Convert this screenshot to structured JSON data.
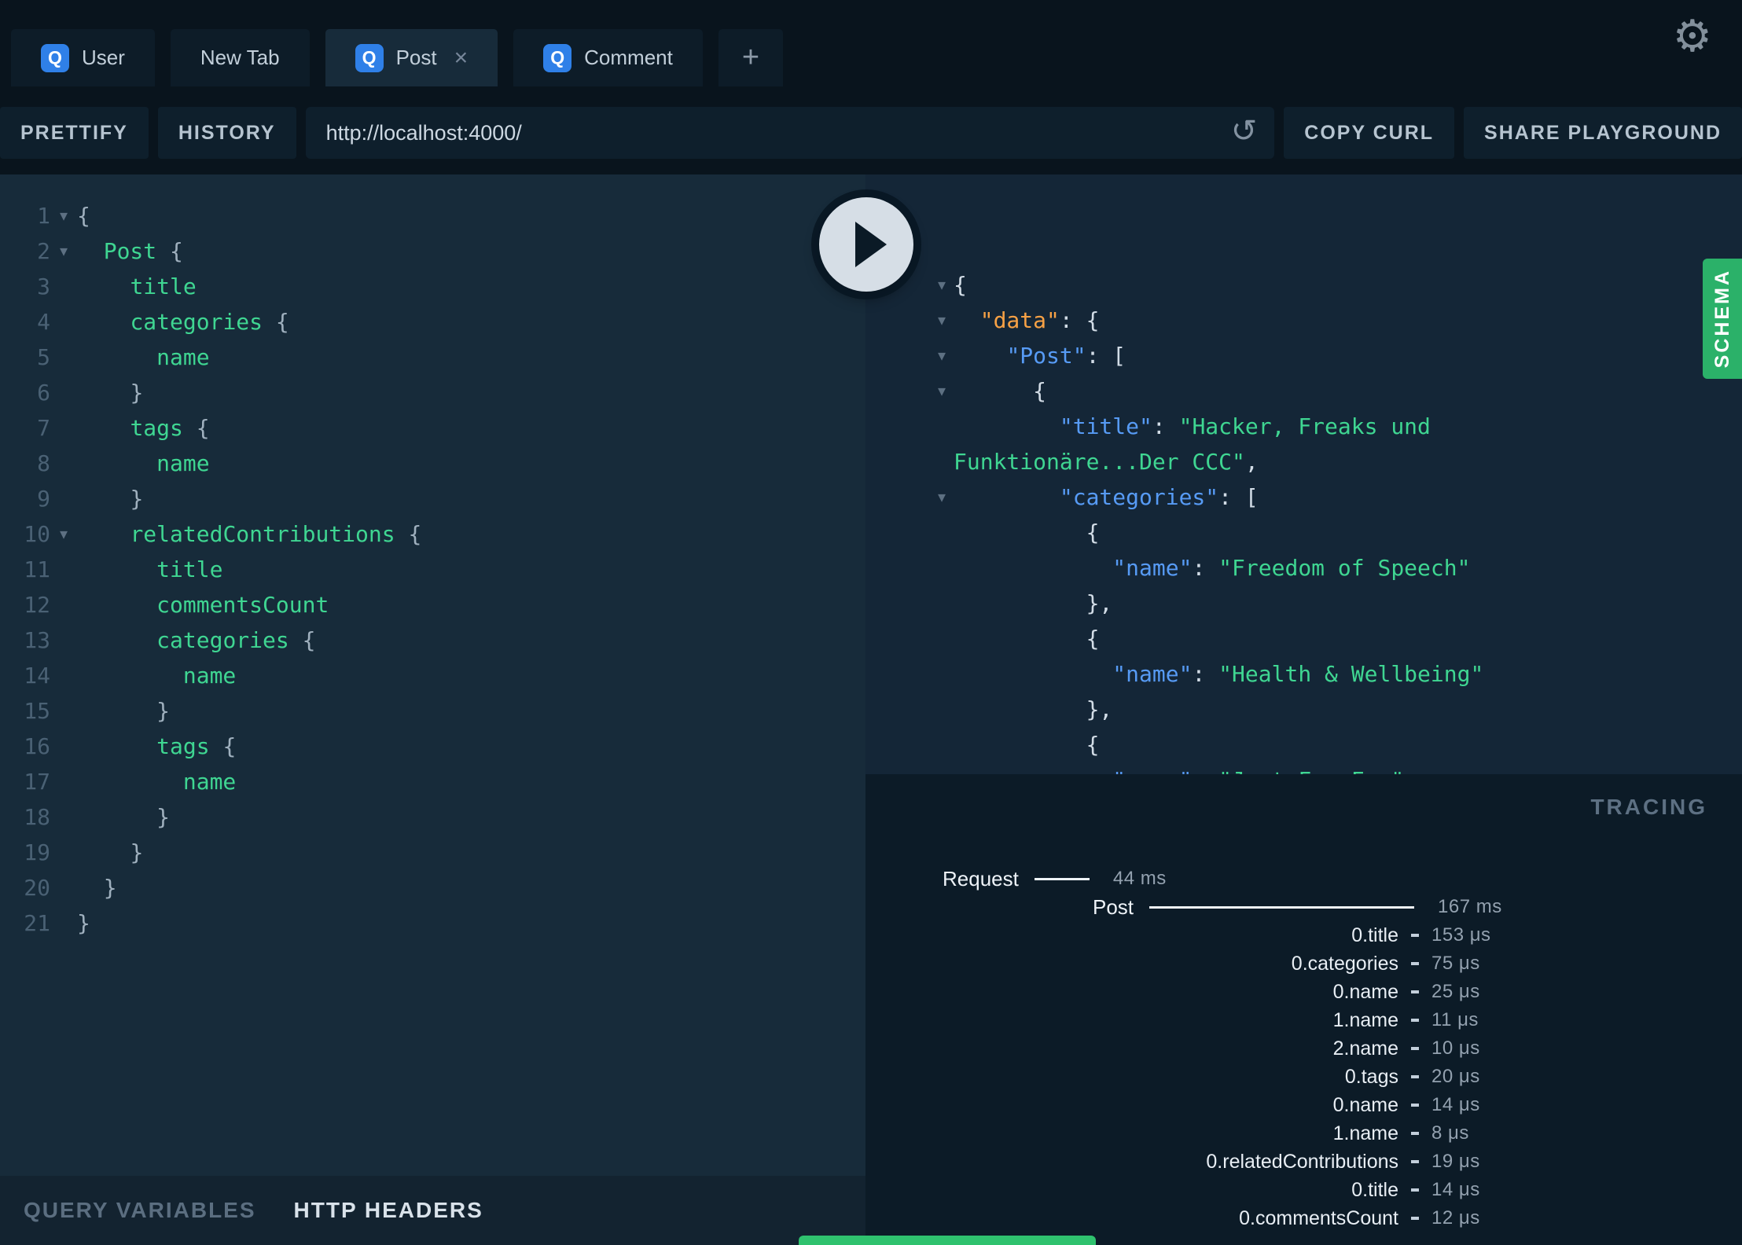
{
  "colors": {
    "topbar": "#09141d",
    "panel-editor": "#172b3a",
    "panel-result": "#142637",
    "panel-tracing": "#0c1b27",
    "badge-blue": "#2f80e8",
    "schema-green": "#2bb169",
    "field-green": "#3fd692",
    "key-blue": "#579bf5",
    "data-orange": "#f7a145",
    "string-green": "#3fd692",
    "toast-green": "#2fc26e"
  },
  "icons": {
    "fold": "▾",
    "close": "×",
    "gear": "⚙",
    "reload": "↺"
  },
  "tab_bar": {
    "plus_label": "+",
    "tabs": [
      {
        "label": "User",
        "badge": "Q",
        "active": false,
        "closable": false
      },
      {
        "label": "New Tab",
        "badge": null,
        "active": false,
        "closable": false
      },
      {
        "label": "Post",
        "badge": "Q",
        "active": true,
        "closable": true
      },
      {
        "label": "Comment",
        "badge": "Q",
        "active": false,
        "closable": false
      }
    ]
  },
  "toolbar": {
    "prettify": "PRETTIFY",
    "history": "HISTORY",
    "endpoint": "http://localhost:4000/",
    "copy_curl": "COPY CURL",
    "share": "SHARE PLAYGROUND"
  },
  "query_editor": {
    "lines": [
      {
        "num": 1,
        "fold": true,
        "segs": [
          [
            "{",
            "p"
          ]
        ]
      },
      {
        "num": 2,
        "fold": true,
        "segs": [
          [
            "  ",
            ""
          ],
          [
            "Post",
            "f"
          ],
          [
            " {",
            "p"
          ]
        ]
      },
      {
        "num": 3,
        "fold": false,
        "segs": [
          [
            "    ",
            ""
          ],
          [
            "title",
            "f"
          ]
        ]
      },
      {
        "num": 4,
        "fold": false,
        "segs": [
          [
            "    ",
            ""
          ],
          [
            "categories",
            "f"
          ],
          [
            " {",
            "p"
          ]
        ]
      },
      {
        "num": 5,
        "fold": false,
        "segs": [
          [
            "      ",
            ""
          ],
          [
            "name",
            "f"
          ]
        ]
      },
      {
        "num": 6,
        "fold": false,
        "segs": [
          [
            "    ",
            ""
          ],
          [
            "}",
            "p"
          ]
        ]
      },
      {
        "num": 7,
        "fold": false,
        "segs": [
          [
            "    ",
            ""
          ],
          [
            "tags",
            "f"
          ],
          [
            " {",
            "p"
          ]
        ]
      },
      {
        "num": 8,
        "fold": false,
        "segs": [
          [
            "      ",
            ""
          ],
          [
            "name",
            "f"
          ]
        ]
      },
      {
        "num": 9,
        "fold": false,
        "segs": [
          [
            "    ",
            ""
          ],
          [
            "}",
            "p"
          ]
        ]
      },
      {
        "num": 10,
        "fold": true,
        "segs": [
          [
            "    ",
            ""
          ],
          [
            "relatedContributions",
            "f"
          ],
          [
            " {",
            "p"
          ]
        ]
      },
      {
        "num": 11,
        "fold": false,
        "segs": [
          [
            "      ",
            ""
          ],
          [
            "title",
            "f"
          ]
        ]
      },
      {
        "num": 12,
        "fold": false,
        "segs": [
          [
            "      ",
            ""
          ],
          [
            "commentsCount",
            "f"
          ]
        ]
      },
      {
        "num": 13,
        "fold": false,
        "segs": [
          [
            "      ",
            ""
          ],
          [
            "categories",
            "f"
          ],
          [
            " {",
            "p"
          ]
        ]
      },
      {
        "num": 14,
        "fold": false,
        "segs": [
          [
            "        ",
            ""
          ],
          [
            "name",
            "f"
          ]
        ]
      },
      {
        "num": 15,
        "fold": false,
        "segs": [
          [
            "      ",
            ""
          ],
          [
            "}",
            "p"
          ]
        ]
      },
      {
        "num": 16,
        "fold": false,
        "segs": [
          [
            "      ",
            ""
          ],
          [
            "tags",
            "f"
          ],
          [
            " {",
            "p"
          ]
        ]
      },
      {
        "num": 17,
        "fold": false,
        "segs": [
          [
            "        ",
            ""
          ],
          [
            "name",
            "f"
          ]
        ]
      },
      {
        "num": 18,
        "fold": false,
        "segs": [
          [
            "      ",
            ""
          ],
          [
            "}",
            "p"
          ]
        ]
      },
      {
        "num": 19,
        "fold": false,
        "segs": [
          [
            "    ",
            ""
          ],
          [
            "}",
            "p"
          ]
        ]
      },
      {
        "num": 20,
        "fold": false,
        "segs": [
          [
            "  ",
            ""
          ],
          [
            "}",
            "p"
          ]
        ]
      },
      {
        "num": 21,
        "fold": false,
        "segs": [
          [
            "}",
            "p"
          ]
        ]
      }
    ]
  },
  "result_viewer": {
    "lines": [
      {
        "fold": true,
        "segs": [
          [
            "{",
            "p"
          ]
        ]
      },
      {
        "fold": true,
        "segs": [
          [
            "  ",
            ""
          ],
          [
            "\"data\"",
            "d"
          ],
          [
            ": {",
            "p"
          ]
        ]
      },
      {
        "fold": true,
        "segs": [
          [
            "    ",
            ""
          ],
          [
            "\"Post\"",
            "k"
          ],
          [
            ": [",
            "p"
          ]
        ]
      },
      {
        "fold": true,
        "segs": [
          [
            "      ",
            ""
          ],
          [
            "{",
            "p"
          ]
        ]
      },
      {
        "fold": false,
        "segs": [
          [
            "        ",
            ""
          ],
          [
            "\"title\"",
            "k"
          ],
          [
            ": ",
            "p"
          ],
          [
            "\"Hacker, Freaks und",
            "s"
          ]
        ]
      },
      {
        "fold": false,
        "segs": [
          [
            "Funktionäre...Der CCC\"",
            "s"
          ],
          [
            ",",
            "p"
          ]
        ]
      },
      {
        "fold": true,
        "segs": [
          [
            "        ",
            ""
          ],
          [
            "\"categories\"",
            "k"
          ],
          [
            ": [",
            "p"
          ]
        ]
      },
      {
        "fold": false,
        "segs": [
          [
            "          ",
            ""
          ],
          [
            "{",
            "p"
          ]
        ]
      },
      {
        "fold": false,
        "segs": [
          [
            "            ",
            ""
          ],
          [
            "\"name\"",
            "k"
          ],
          [
            ": ",
            "p"
          ],
          [
            "\"Freedom of Speech\"",
            "s"
          ]
        ]
      },
      {
        "fold": false,
        "segs": [
          [
            "          ",
            ""
          ],
          [
            "},",
            "p"
          ]
        ]
      },
      {
        "fold": false,
        "segs": [
          [
            "          ",
            ""
          ],
          [
            "{",
            "p"
          ]
        ]
      },
      {
        "fold": false,
        "segs": [
          [
            "            ",
            ""
          ],
          [
            "\"name\"",
            "k"
          ],
          [
            ": ",
            "p"
          ],
          [
            "\"Health & Wellbeing\"",
            "s"
          ]
        ]
      },
      {
        "fold": false,
        "segs": [
          [
            "          ",
            ""
          ],
          [
            "},",
            "p"
          ]
        ]
      },
      {
        "fold": false,
        "segs": [
          [
            "          ",
            ""
          ],
          [
            "{",
            "p"
          ]
        ]
      },
      {
        "fold": false,
        "segs": [
          [
            "            ",
            ""
          ],
          [
            "\"name\"",
            "k"
          ],
          [
            ": ",
            "p"
          ],
          [
            "\"Just For Fun\"",
            "s"
          ]
        ]
      },
      {
        "fold": false,
        "segs": [
          [
            "          ",
            ""
          ],
          [
            "}",
            "p"
          ]
        ]
      },
      {
        "fold": false,
        "segs": [
          [
            "        ",
            ""
          ],
          [
            "]",
            "p"
          ]
        ]
      }
    ]
  },
  "schema_tab": {
    "label": "SCHEMA"
  },
  "tracing": {
    "title": "TRACING",
    "spans": [
      {
        "label": "Request",
        "duration": "44 ms",
        "kind": "root",
        "indent": 98,
        "bar": 70
      },
      {
        "label": "Post",
        "duration": "167 ms",
        "kind": "root",
        "indent": 289,
        "bar": 337
      },
      {
        "label": "0.title",
        "duration": "153 μs",
        "kind": "leaf"
      },
      {
        "label": "0.categories",
        "duration": "75 μs",
        "kind": "leaf"
      },
      {
        "label": "0.name",
        "duration": "25 μs",
        "kind": "leaf"
      },
      {
        "label": "1.name",
        "duration": "11 μs",
        "kind": "leaf"
      },
      {
        "label": "2.name",
        "duration": "10 μs",
        "kind": "leaf"
      },
      {
        "label": "0.tags",
        "duration": "20 μs",
        "kind": "leaf"
      },
      {
        "label": "0.name",
        "duration": "14 μs",
        "kind": "leaf"
      },
      {
        "label": "1.name",
        "duration": "8 μs",
        "kind": "leaf"
      },
      {
        "label": "0.relatedContributions",
        "duration": "19 μs",
        "kind": "leaf"
      },
      {
        "label": "0.title",
        "duration": "14 μs",
        "kind": "leaf"
      },
      {
        "label": "0.commentsCount",
        "duration": "12 μs",
        "kind": "leaf"
      }
    ]
  },
  "editor_footer": {
    "query_variables": "QUERY VARIABLES",
    "http_headers": "HTTP HEADERS"
  }
}
